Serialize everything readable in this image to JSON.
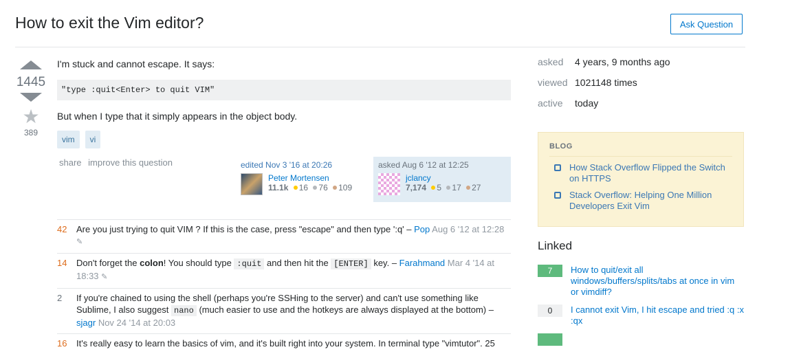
{
  "question": {
    "title": "How to exit the Vim editor?",
    "ask_button": "Ask Question",
    "votes": "1445",
    "favorites": "389",
    "body_intro": "I'm stuck and cannot escape. It says:",
    "code": "\"type :quit<Enter> to quit VIM\"",
    "body_after": "But when I type that it simply appears in the object body.",
    "tags": [
      "vim",
      "vi"
    ],
    "menu": {
      "share": "share",
      "improve": "improve this question"
    }
  },
  "edited": {
    "action": "edited Nov 3 '16 at 20:26",
    "user": "Peter Mortensen",
    "rep": "11.1k",
    "gold": "16",
    "silver": "76",
    "bronze": "109"
  },
  "asked": {
    "action": "asked Aug 6 '12 at 12:25",
    "user": "jclancy",
    "rep": "7,174",
    "gold": "5",
    "silver": "17",
    "bronze": "27"
  },
  "comments": [
    {
      "score": "42",
      "text1": "Are you just trying to quit VIM ? If this is the case, press \"escape\" and then type ':q' – ",
      "user": "Pop",
      "date": "Aug 6 '12 at 12:28"
    },
    {
      "score": "14",
      "text1": "Don't forget the ",
      "bold": "colon",
      "text2": "! You should type ",
      "code1": ":quit",
      "text3": " and then hit the ",
      "code2": "[ENTER]",
      "text4": " key. – ",
      "user": "Farahmand",
      "date": "Mar 4 '14 at 18:33"
    },
    {
      "score": "2",
      "text1": "If you're chained to using the shell (perhaps you're SSHing to the server) and can't use something like Sublime, I also suggest ",
      "code1": "nano",
      "text2": " (much easier to use and the hotkeys are always displayed at the bottom) – ",
      "user": "sjagr",
      "date": "Nov 24 '14 at 20:03"
    },
    {
      "score": "16",
      "text1": "It's really easy to learn the basics of vim, and it's built right into your system. In terminal type \"vimtutor\". 25"
    }
  ],
  "stats": {
    "asked_label": "asked",
    "asked_val": "4 years, 9 months ago",
    "viewed_label": "viewed",
    "viewed_val": "1021148 times",
    "active_label": "active",
    "active_val": "today"
  },
  "blog": {
    "header": "BLOG",
    "items": [
      "How Stack Overflow Flipped the Switch on HTTPS",
      "Stack Overflow: Helping One Million Developers Exit Vim"
    ]
  },
  "linked": {
    "title": "Linked",
    "items": [
      {
        "count": "7",
        "text": "How to quit/exit all windows/buffers/splits/tabs at once in vim or vimdiff?"
      },
      {
        "count": "0",
        "text": "I cannot exit Vim, I hit escape and tried :q :x :qx"
      }
    ]
  }
}
